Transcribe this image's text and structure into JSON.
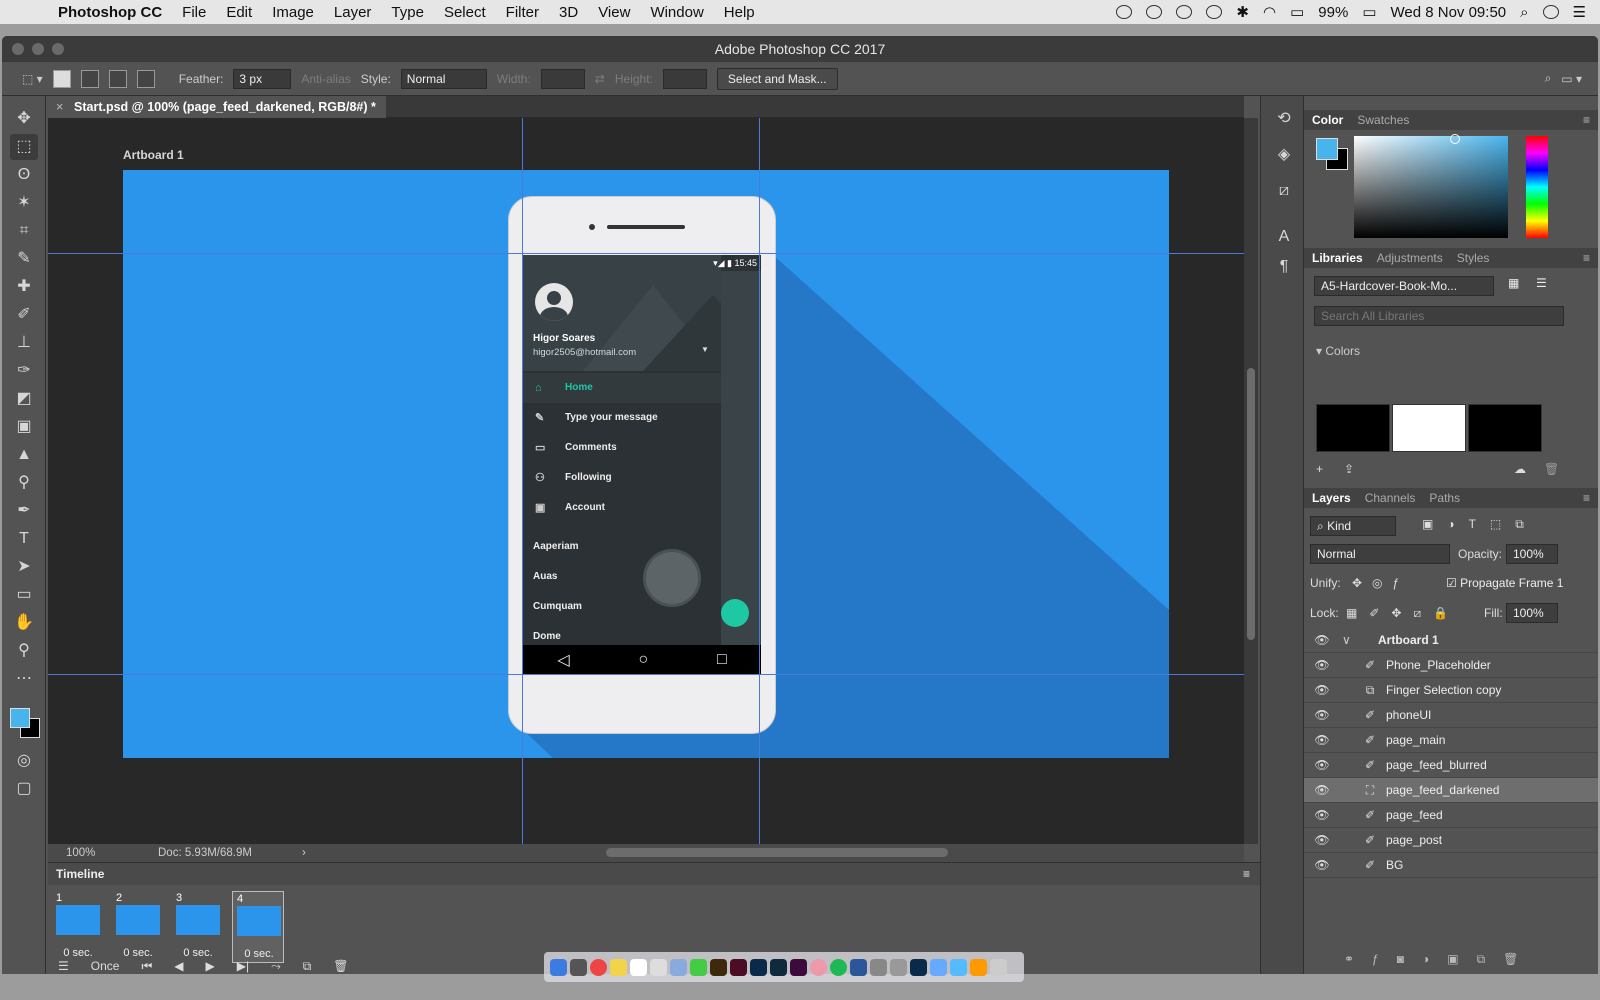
{
  "menubar": {
    "app": "Photoshop CC",
    "items": [
      "File",
      "Edit",
      "Image",
      "Layer",
      "Type",
      "Select",
      "Filter",
      "3D",
      "View",
      "Window",
      "Help"
    ],
    "battery": "99%",
    "clock": "Wed 8 Nov  09:50"
  },
  "window": {
    "title": "Adobe Photoshop CC 2017"
  },
  "options": {
    "feather_label": "Feather:",
    "feather_value": "3 px",
    "antialias": "Anti-alias",
    "style_label": "Style:",
    "style_value": "Normal",
    "width_label": "Width:",
    "height_label": "Height:",
    "select_mask": "Select and Mask..."
  },
  "document": {
    "tab": "Start.psd @ 100% (page_feed_darkened, RGB/8#) *",
    "artboard": "Artboard 1",
    "zoom": "100%",
    "doc_size": "Doc: 5.93M/68.9M"
  },
  "phone": {
    "time": "15:45",
    "user_name": "Higor Soares",
    "user_email": "higor2505@hotmail.com",
    "nav": [
      {
        "label": "Home",
        "icon": "home-icon"
      },
      {
        "label": "Type your message",
        "icon": "pencil-icon"
      },
      {
        "label": "Comments",
        "icon": "comment-icon"
      },
      {
        "label": "Following",
        "icon": "people-icon"
      },
      {
        "label": "Account",
        "icon": "account-icon"
      }
    ],
    "subitems": [
      "Aaperiam",
      "Auas",
      "Cumquam",
      "Dome"
    ]
  },
  "timeline": {
    "title": "Timeline",
    "frames": [
      {
        "num": "1",
        "delay": "0 sec."
      },
      {
        "num": "2",
        "delay": "0 sec."
      },
      {
        "num": "3",
        "delay": "0 sec."
      },
      {
        "num": "4",
        "delay": "0 sec."
      }
    ],
    "loop": "Once"
  },
  "color_panel": {
    "tabs": [
      "Color",
      "Swatches"
    ],
    "fg": "#48b4ec",
    "bg": "#000000"
  },
  "libraries_panel": {
    "tabs": [
      "Libraries",
      "Adjustments",
      "Styles"
    ],
    "library": "A5-Hardcover-Book-Mo...",
    "search_placeholder": "Search All Libraries",
    "section": "Colors",
    "swatches": [
      "#000000",
      "#ffffff",
      "#000000"
    ]
  },
  "layers_panel": {
    "tabs": [
      "Layers",
      "Channels",
      "Paths"
    ],
    "filter": "Kind",
    "blend": "Normal",
    "opacity_label": "Opacity:",
    "opacity": "100%",
    "unify_label": "Unify:",
    "propagate": "Propagate Frame 1",
    "lock_label": "Lock:",
    "fill_label": "Fill:",
    "fill": "100%",
    "group": "Artboard 1",
    "layers": [
      "Phone_Placeholder",
      "Finger Selection copy",
      "phoneUI",
      "page_main",
      "page_feed_blurred",
      "page_feed_darkened",
      "page_feed",
      "page_post",
      "BG"
    ],
    "selected": "page_feed_darkened"
  },
  "colors": {
    "artboard": "#2b95ec",
    "accent": "#1ec8a5"
  }
}
